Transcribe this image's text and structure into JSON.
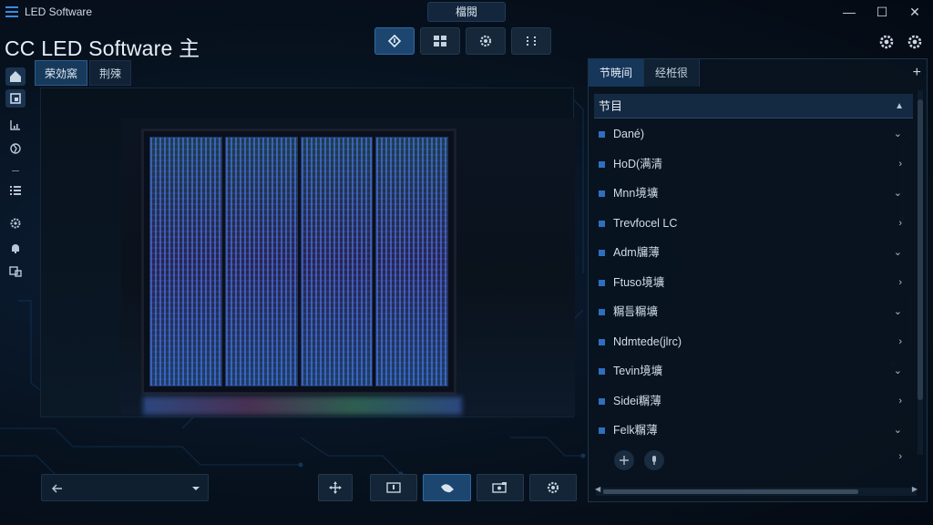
{
  "window": {
    "title": "LED Software",
    "center_tab": "檔閱",
    "controls": {
      "minimize": "—",
      "maximize": "☐",
      "close": "✕"
    }
  },
  "header": {
    "app_title": "CC LED Software 主",
    "toolbar": [
      {
        "icon": "diamond-arrow-icon",
        "active": true
      },
      {
        "icon": "grid-layout-icon",
        "active": false
      },
      {
        "icon": "settings-icon",
        "active": false
      },
      {
        "icon": "dots-grid-icon",
        "active": false
      }
    ],
    "right_icons": [
      "gear-icon",
      "settings-icon"
    ]
  },
  "sidebar": {
    "items": [
      {
        "icon": "home-icon",
        "active": true
      },
      {
        "icon": "files-icon",
        "active": true
      },
      {
        "icon": "chart-icon",
        "active": false
      },
      {
        "icon": "globe-icon",
        "active": false
      },
      {
        "icon": "list-icon",
        "active": false
      },
      {
        "icon": "gear-icon",
        "active": false
      },
      {
        "icon": "bell-icon",
        "active": false
      },
      {
        "icon": "devices-icon",
        "active": false
      }
    ]
  },
  "center": {
    "tabs": [
      {
        "label": "荣効窯",
        "active": true
      },
      {
        "label": "荆殐",
        "active": false
      }
    ],
    "bottom_controls": {
      "back_icon": "arrow-left-icon",
      "dropdown_icon": "chevron-down-icon",
      "buttons": [
        "move-icon",
        "frame-icon",
        "hand-icon",
        "camera-icon",
        "gear-icon"
      ],
      "active_index": 2
    }
  },
  "right_panel": {
    "tabs": [
      {
        "label": "节暁间",
        "active": true
      },
      {
        "label": "经栣很",
        "active": false
      }
    ],
    "add_label": "+",
    "list_header": "节目",
    "items": [
      {
        "label": "Dané)",
        "arrow": "⌄"
      },
      {
        "label": "HoD(满清",
        "arrow": "›"
      },
      {
        "label": "Mnn境壙",
        "arrow": "⌄"
      },
      {
        "label": "Trevfocel LC",
        "arrow": "›"
      },
      {
        "label": "Adm牖薄",
        "arrow": "⌄"
      },
      {
        "label": "Ftuso境壙",
        "arrow": "›"
      },
      {
        "label": "糏틈糏壙",
        "arrow": "⌄"
      },
      {
        "label": "Ndmtede(jlrc)",
        "arrow": "›"
      },
      {
        "label": "Tevin境壙",
        "arrow": "⌄"
      },
      {
        "label": "Sidei糏薄",
        "arrow": "›"
      },
      {
        "label": "Felk糏薄",
        "arrow": "⌄"
      }
    ],
    "footer_arrow": "›"
  },
  "colors": {
    "accent": "#2f6aa3",
    "background": "#07121f",
    "bullet": "#2f6fbf"
  }
}
